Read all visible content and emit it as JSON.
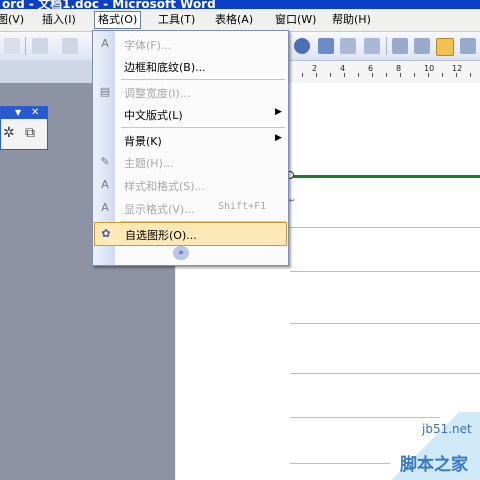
{
  "window": {
    "title": "ord - 文档1.doc - Microsoft Word"
  },
  "menubar": {
    "items": [
      {
        "label": "图(V)"
      },
      {
        "label": "插入(I)"
      },
      {
        "label": "格式(O)"
      },
      {
        "label": "工具(T)"
      },
      {
        "label": "表格(A)"
      },
      {
        "label": "窗口(W)"
      },
      {
        "label": "帮助(H)"
      }
    ]
  },
  "ruler": {
    "labels": [
      "2",
      "4",
      "6",
      "8",
      "10",
      "12"
    ]
  },
  "format_menu": {
    "items": [
      {
        "label": "字体(F)...",
        "enabled": false,
        "icon": "font-icon"
      },
      {
        "label": "边框和底纹(B)...",
        "enabled": true
      },
      {
        "label": "调整宽度(I)...",
        "enabled": false,
        "icon": "adjust-width-icon"
      },
      {
        "label": "中文版式(L)",
        "enabled": true,
        "arrow": "▶"
      },
      {
        "label": "背景(K)",
        "enabled": true,
        "arrow": "▶"
      },
      {
        "label": "主题(H)...",
        "enabled": false,
        "icon": "theme-icon"
      },
      {
        "label": "样式和格式(S)...",
        "enabled": false,
        "icon": "styles-icon"
      },
      {
        "label": "显示格式(V)...",
        "enabled": false,
        "shortcut": "Shift+F1",
        "icon": "reveal-format-icon"
      },
      {
        "label": "自选图形(O)...",
        "enabled": true,
        "highlighted": true,
        "icon": "autoshape-icon"
      }
    ],
    "expand_glyph": "»"
  },
  "watermark": {
    "site": "jb51.net",
    "name": "脚本之家"
  },
  "colors": {
    "titlebar": "#0a3fc8",
    "highlight_bg": "#fde9b8",
    "highlight_border": "#cf9a2f",
    "green_line": "#1e7a1e"
  }
}
